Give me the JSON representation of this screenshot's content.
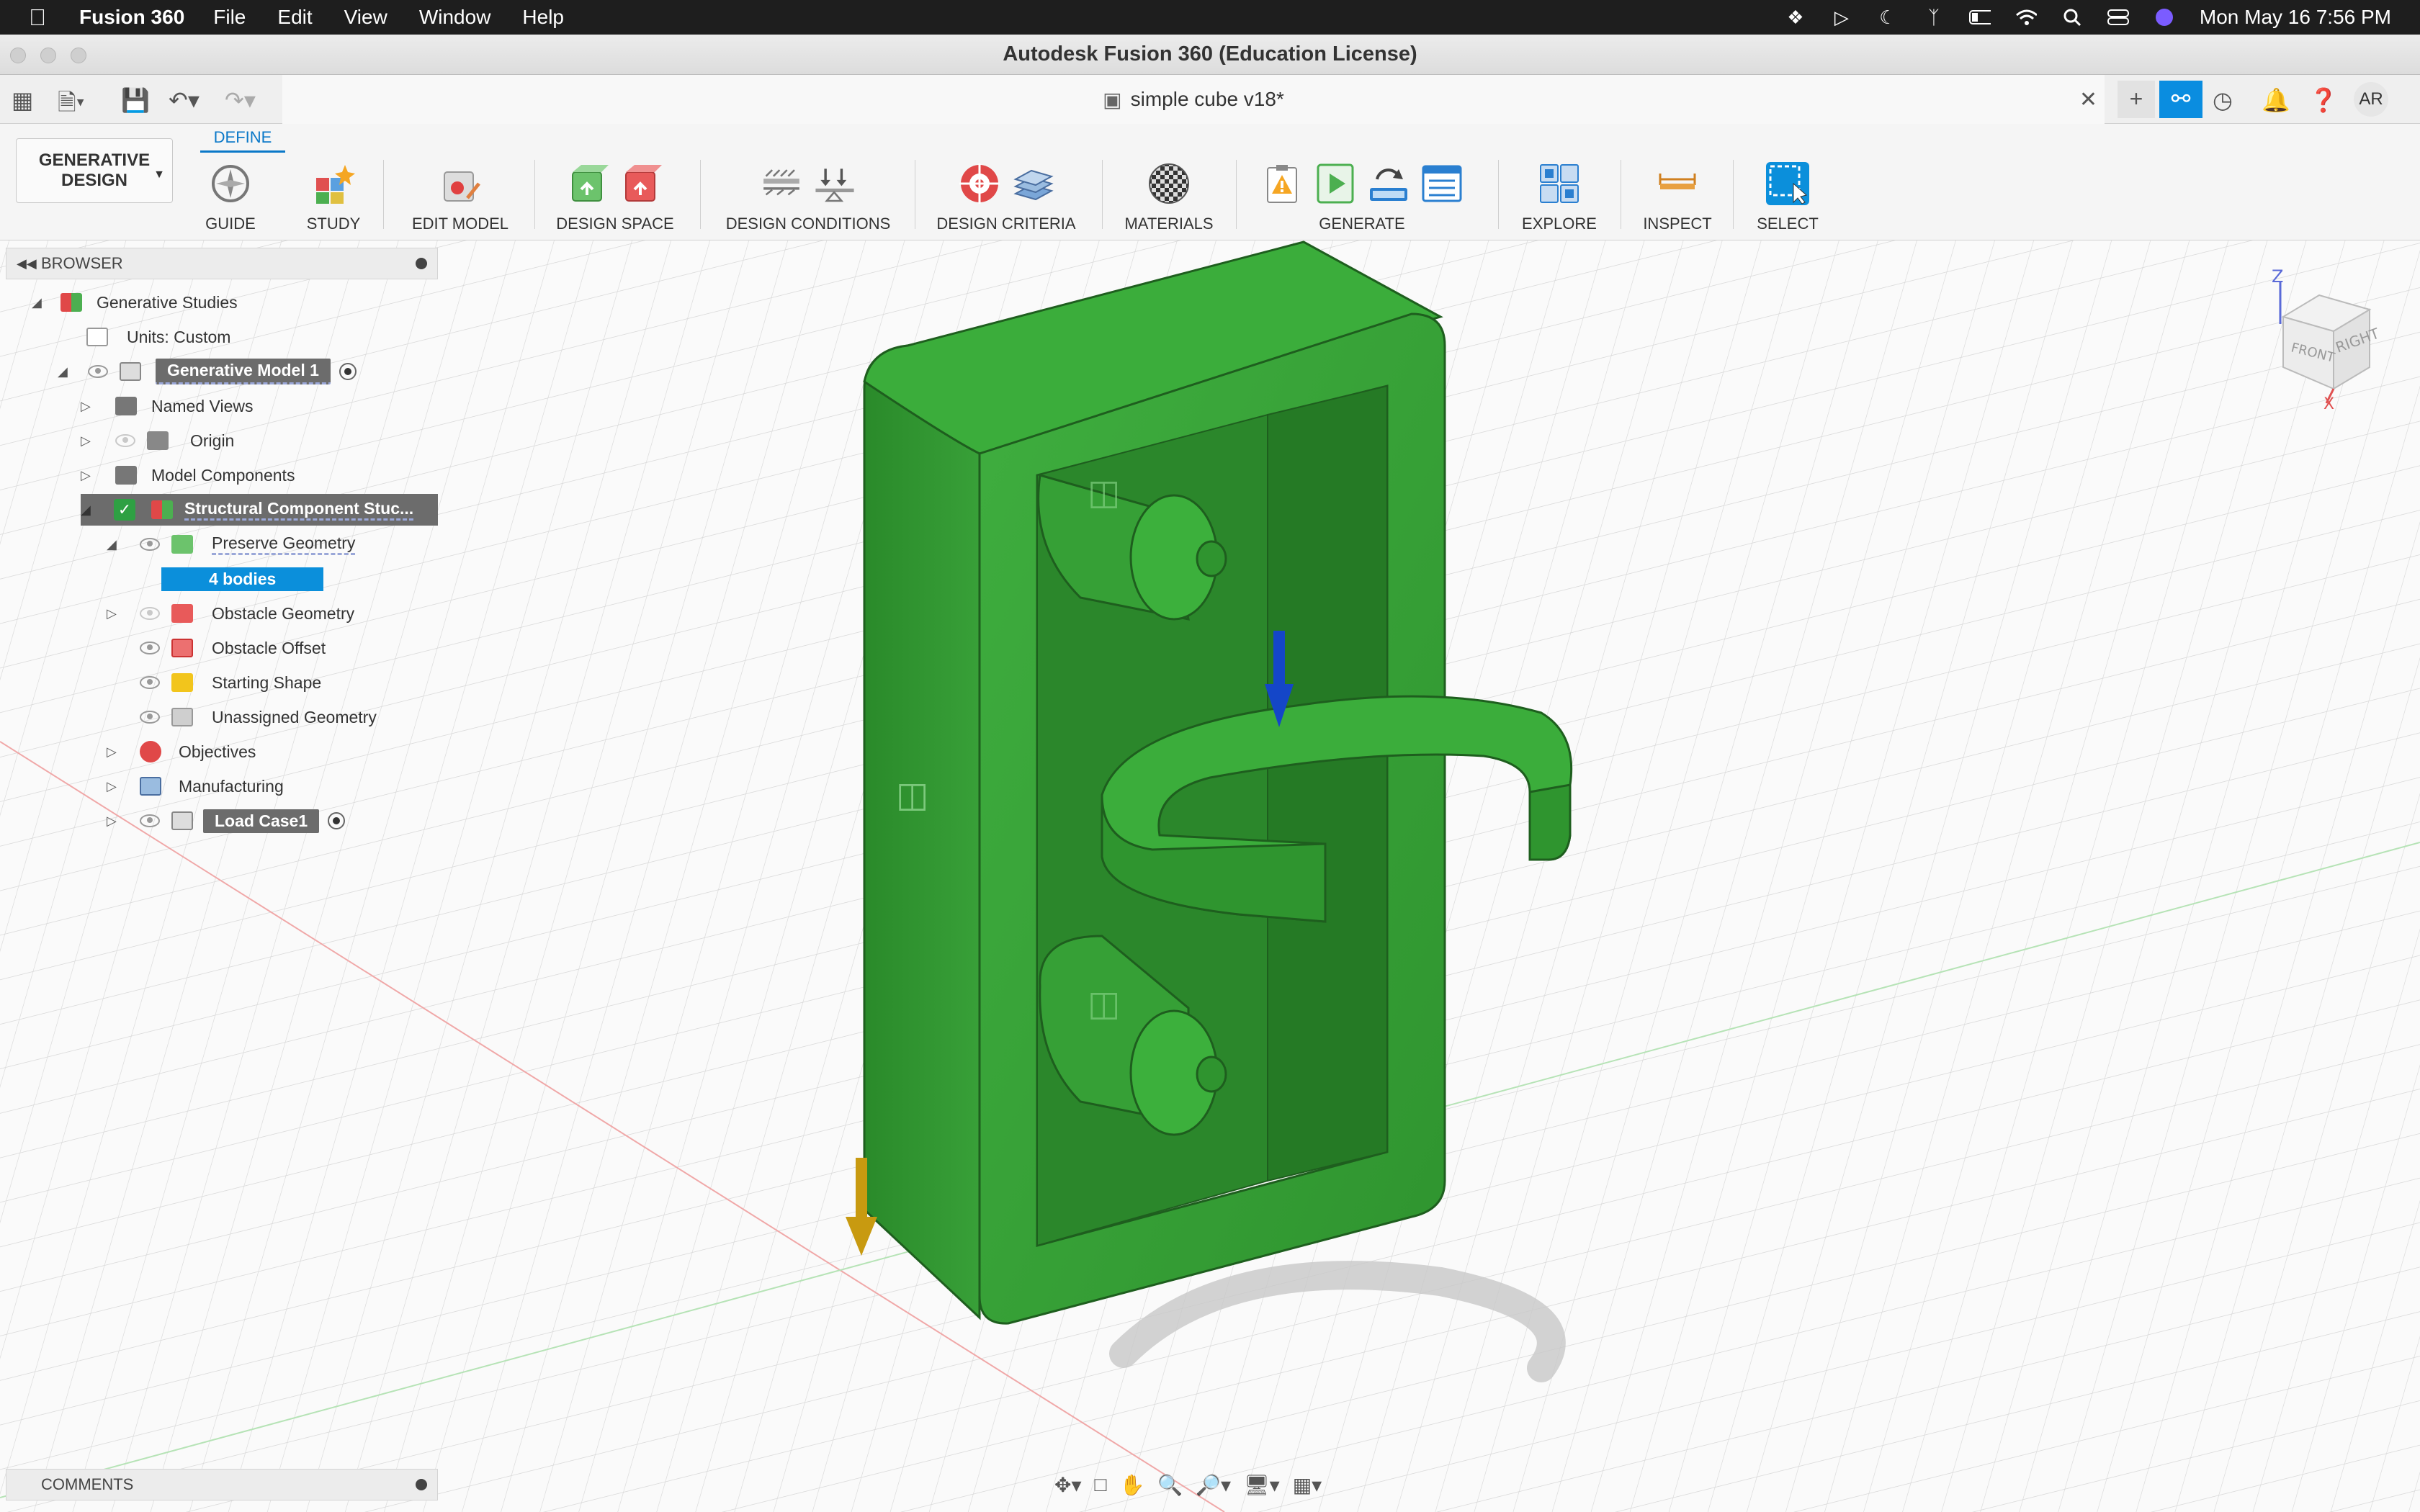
{
  "menubar": {
    "app_name": "Fusion 360",
    "items": [
      "File",
      "Edit",
      "View",
      "Window",
      "Help"
    ],
    "datetime": "Mon May 16  7:56 PM"
  },
  "window": {
    "title": "Autodesk Fusion 360 (Education License)"
  },
  "document_tab": {
    "name": "simple cube v18*"
  },
  "user": {
    "initials": "AR"
  },
  "ribbon": {
    "workspace_label_line1": "GENERATIVE",
    "workspace_label_line2": "DESIGN",
    "active_tab": "DEFINE",
    "groups": [
      "GUIDE",
      "STUDY",
      "EDIT MODEL",
      "DESIGN SPACE",
      "DESIGN CONDITIONS",
      "DESIGN CRITERIA",
      "MATERIALS",
      "GENERATE",
      "EXPLORE",
      "INSPECT",
      "SELECT"
    ]
  },
  "browser": {
    "title": "BROWSER",
    "items": [
      "Generative Studies",
      "Units: Custom",
      "Generative Model 1",
      "Named Views",
      "Origin",
      "Model Components",
      "Structural Component Stuc...",
      "Preserve Geometry",
      "4 bodies",
      "Obstacle Geometry",
      "Obstacle Offset",
      "Starting Shape",
      "Unassigned Geometry",
      "Objectives",
      "Manufacturing",
      "Load Case1"
    ]
  },
  "comments": {
    "title": "COMMENTS"
  },
  "viewcube": {
    "face_front": "FRONT",
    "face_right": "RIGHT",
    "axis_z": "Z",
    "axis_x": "X"
  },
  "colors": {
    "model_green": "#35a236",
    "accent_blue": "#0a78c8",
    "select_blue": "#0b8fdb"
  }
}
